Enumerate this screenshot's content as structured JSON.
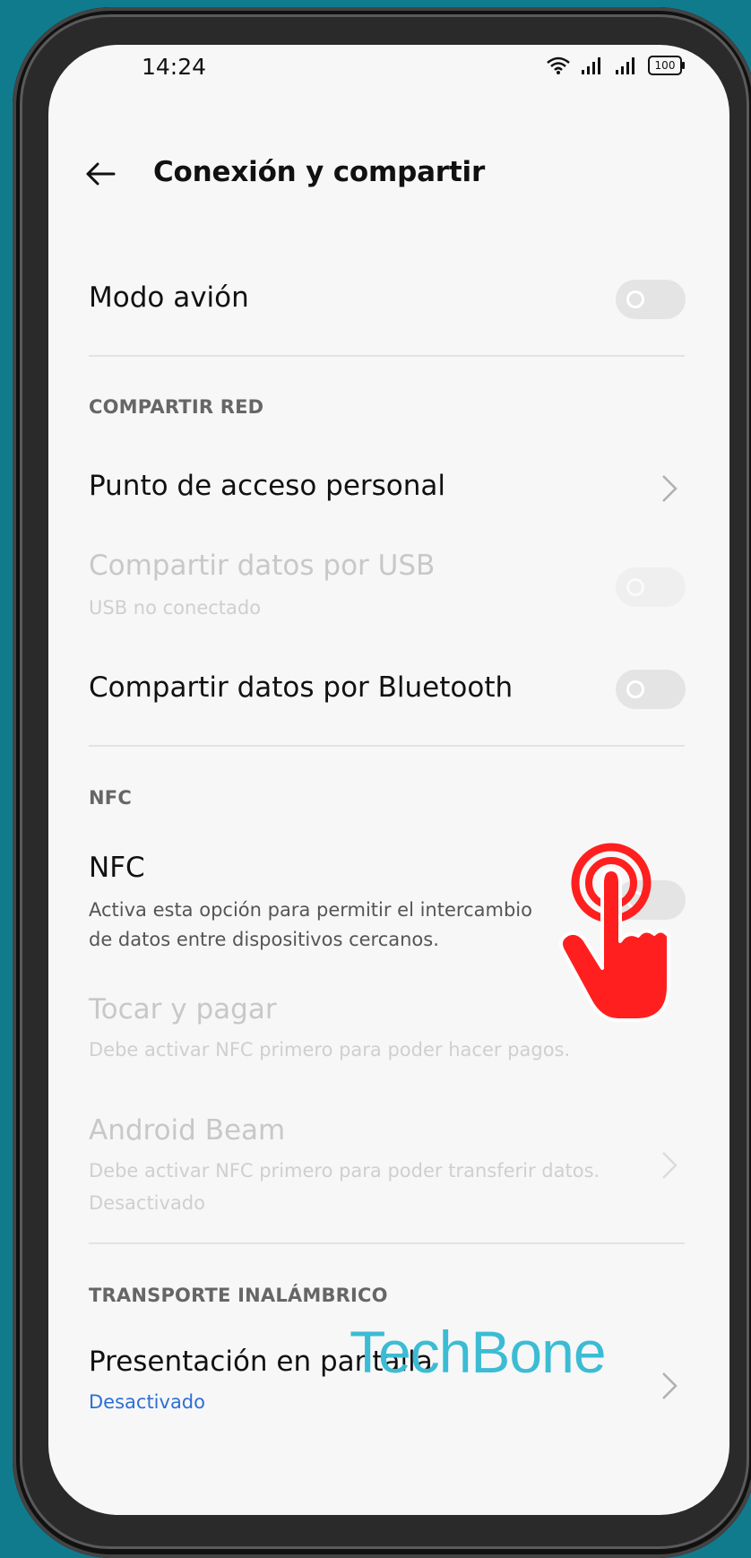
{
  "status_bar": {
    "time": "14:24",
    "battery": "100"
  },
  "header": {
    "title": "Conexión y compartir"
  },
  "airplane": {
    "label": "Modo avión",
    "enabled": false
  },
  "section_share": {
    "label": "COMPARTIR RED"
  },
  "hotspot": {
    "label": "Punto de acceso personal"
  },
  "usb_tether": {
    "label": "Compartir datos por USB",
    "sub": "USB no conectado",
    "enabled": false
  },
  "bt_tether": {
    "label": "Compartir datos por Bluetooth",
    "enabled": false
  },
  "section_nfc": {
    "label": "NFC"
  },
  "nfc": {
    "label": "NFC",
    "sub_line1": "Activa esta opción para permitir el intercambio",
    "sub_line2": "de datos entre dispositivos cercanos.",
    "enabled": false
  },
  "tap_pay": {
    "label": "Tocar y pagar",
    "sub": "Debe activar NFC primero para poder hacer pagos."
  },
  "android_beam": {
    "label": "Android Beam",
    "sub": "Debe activar NFC primero para poder transferir datos.",
    "status": "Desactivado"
  },
  "section_wireless": {
    "label": "TRANSPORTE INALÁMBRICO"
  },
  "screen_cast": {
    "label": "Presentación en pantalla",
    "status": "Desactivado"
  },
  "watermark": {
    "text": "TechBone"
  },
  "colors": {
    "background": "#117b8e",
    "accent": "#2c6fd6",
    "hand": "#ff1f1f",
    "watermark": "#3bbcd4"
  }
}
